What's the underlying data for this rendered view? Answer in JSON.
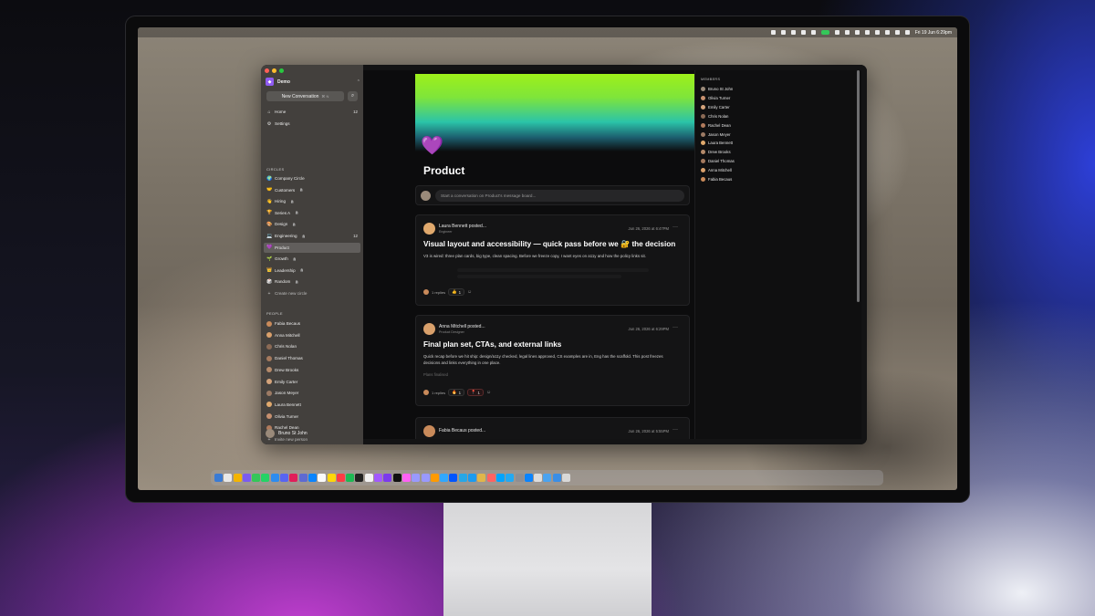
{
  "menubar": {
    "apple": "",
    "clock": "Fri 19 Jun 6:29pm"
  },
  "workspace": {
    "badge": "",
    "name": "Demo",
    "new_conversation": "New Conversation",
    "shortcut": "⌘ N"
  },
  "nav": [
    {
      "label": "Home",
      "count": "12",
      "icon": "home-icon"
    },
    {
      "label": "Settings",
      "count": "",
      "icon": "gear-icon"
    }
  ],
  "circles_header": "CIRCLES",
  "circles": [
    {
      "emoji": "🌍",
      "label": "Company Circle",
      "lock": false,
      "count": ""
    },
    {
      "emoji": "🤝",
      "label": "Customers",
      "lock": true,
      "count": ""
    },
    {
      "emoji": "👋",
      "label": "Hiring",
      "lock": true,
      "count": ""
    },
    {
      "emoji": "🏆",
      "label": "Series A",
      "lock": true,
      "count": ""
    },
    {
      "emoji": "🎨",
      "label": "Design",
      "lock": true,
      "count": ""
    },
    {
      "emoji": "💻",
      "label": "Engineering",
      "lock": true,
      "count": "12"
    },
    {
      "emoji": "💜",
      "label": "Product",
      "lock": false,
      "count": "",
      "active": true
    },
    {
      "emoji": "🌱",
      "label": "Growth",
      "lock": true,
      "count": ""
    },
    {
      "emoji": "👑",
      "label": "Leadership",
      "lock": true,
      "count": ""
    },
    {
      "emoji": "🎲",
      "label": "Random",
      "lock": true,
      "count": ""
    }
  ],
  "create_circle": "Create new circle",
  "people_header": "PEOPLE",
  "people": [
    {
      "name": "Fabia Becaus",
      "color": "#c98a5a"
    },
    {
      "name": "Anna Mitchell",
      "color": "#d9a06b"
    },
    {
      "name": "Chris Nolan",
      "color": "#8b6a55"
    },
    {
      "name": "Daniel Thomas",
      "color": "#a57a5e"
    },
    {
      "name": "Drew Brooks",
      "color": "#b58a6a"
    },
    {
      "name": "Emily Carter",
      "color": "#d4a37b"
    },
    {
      "name": "Jason Meyer",
      "color": "#9c7a64"
    },
    {
      "name": "Laura Bennett",
      "color": "#e0a96d"
    },
    {
      "name": "Olivia Turner",
      "color": "#c7906f"
    },
    {
      "name": "Rachel Dean",
      "color": "#b07a5c"
    }
  ],
  "invite": "Invite new person",
  "me": {
    "name": "Bruno St John"
  },
  "circle": {
    "emoji": "💜",
    "title": "Product",
    "menu_icon": "↔"
  },
  "composer": {
    "placeholder": "Start a conversation on Product's message board..."
  },
  "posts": [
    {
      "author": "Laura Bennett posted...",
      "role": "Engineer",
      "date": "Jun 26, 2026 at 6:47PM",
      "title": "Visual layout and accessibility — quick pass before we 🔐 the decision",
      "body": "V3 is wired: three plan cards, big type, clean spacing. Before we freeze copy, I want eyes on a11y and how the policy links sit.",
      "faded": "",
      "replies": "1 replies",
      "reactions": [
        {
          "emoji": "👍",
          "count": "1",
          "style": "normal"
        }
      ]
    },
    {
      "author": "Anna Mitchell posted...",
      "role": "Product Designer",
      "date": "Jun 26, 2026 at 6:29PM",
      "title": "Final plan set, CTAs, and external links",
      "body": "Quick recap before we hit ship: design/a11y checked, legal lines approved, CS examples are in, Eng has the scaffold. This post freezes decisions and links everything in one place.",
      "faded": "Plans finalised",
      "replies": "1 replies",
      "reactions": [
        {
          "emoji": "🔥",
          "count": "1",
          "style": "normal"
        },
        {
          "emoji": "📍",
          "count": "1",
          "style": "red"
        }
      ]
    },
    {
      "author": "Fabia Becaus posted...",
      "role": "",
      "date": "Jun 26, 2026 at 5:55PM",
      "title": "",
      "body": "",
      "faded": "",
      "replies": "",
      "reactions": []
    }
  ],
  "members": {
    "header": "MEMBERS",
    "list": [
      {
        "name": "Bruno St John",
        "color": "#9a8a7a"
      },
      {
        "name": "Olivia Turner",
        "color": "#c7906f"
      },
      {
        "name": "Emily Carter",
        "color": "#d4a37b"
      },
      {
        "name": "Chris Nolan",
        "color": "#8b6a55"
      },
      {
        "name": "Rachel Dean",
        "color": "#b07a5c"
      },
      {
        "name": "Jason Meyer",
        "color": "#9c7a64"
      },
      {
        "name": "Laura Bennett",
        "color": "#e0a96d"
      },
      {
        "name": "Drew Brooks",
        "color": "#b58a6a"
      },
      {
        "name": "Daniel Thomas",
        "color": "#a57a5e"
      },
      {
        "name": "Anna Mitchell",
        "color": "#d9a06b"
      },
      {
        "name": "Fabia Becaus",
        "color": "#c98a5a"
      }
    ]
  },
  "colors": {
    "accent": "#8f5bf2",
    "hero_top": "#9ef01a",
    "hero_mid": "#2bc4a8"
  },
  "dock_apps": [
    "finder-icon",
    "launchpad-icon",
    "chrome-icon",
    "arc-icon",
    "messages-icon",
    "whatsapp-icon",
    "mail-icon",
    "discord-icon",
    "slack-icon",
    "linear-icon",
    "testflight-icon",
    "calendar-icon",
    "notes-icon",
    "music-icon",
    "spotify-icon",
    "terminal-icon",
    "notion-icon",
    "figma-icon",
    "obsidian-icon",
    "cursor-icon",
    "xd-icon",
    "after-effects-icon",
    "premiere-icon",
    "illustrator-icon",
    "photoshop-icon",
    "framer-icon",
    "telegram-icon",
    "xcode-icon",
    "tower-icon",
    "raycast-icon",
    "warp-icon",
    "vscode-icon",
    "settings-icon",
    "app-store-icon",
    "preview-icon",
    "folder-icon",
    "downloads-icon",
    "trash-icon"
  ]
}
